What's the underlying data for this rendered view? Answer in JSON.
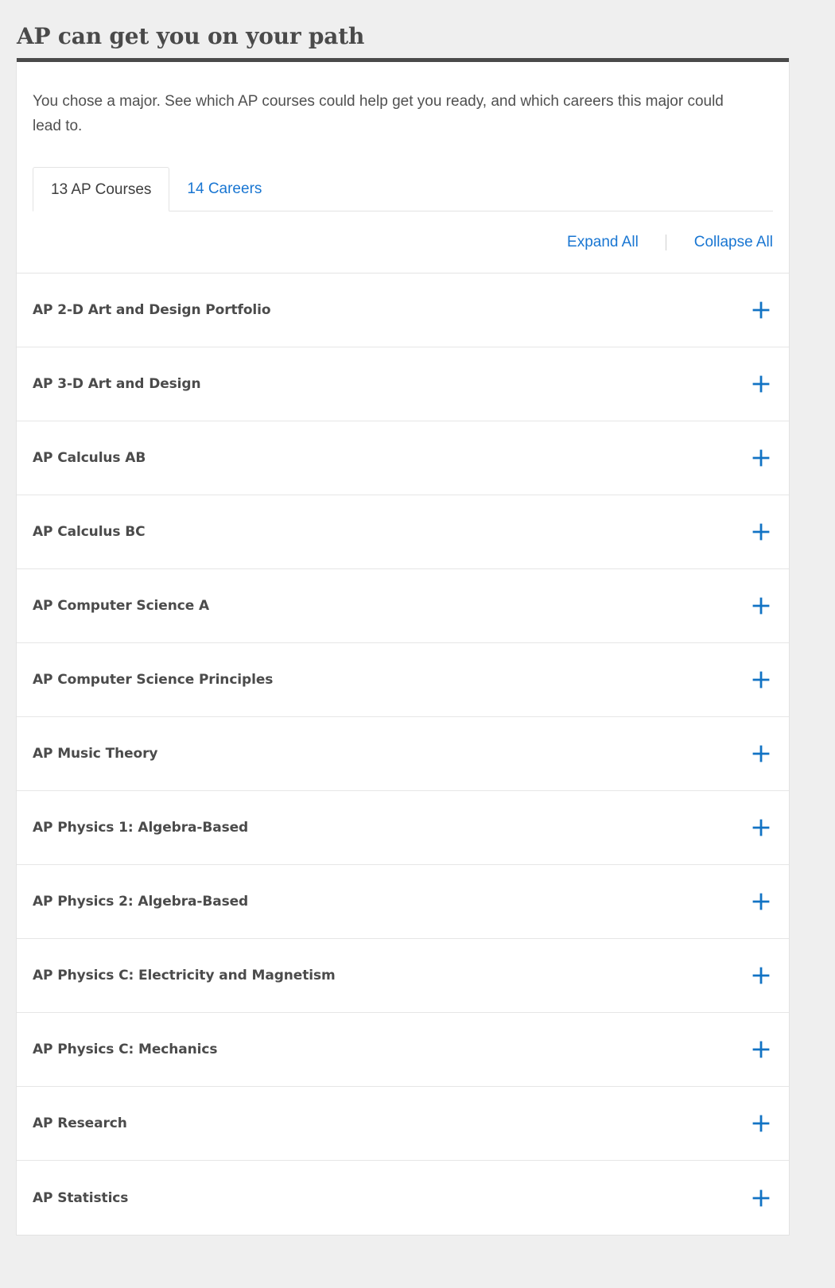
{
  "page": {
    "title": "AP can get you on your path",
    "background_color": "#efefef"
  },
  "card": {
    "accent_bar_color": "#4a4a4a",
    "intro": "You chose a major. See which AP courses could help get you ready, and which careers this major could lead to.",
    "tabs": [
      {
        "label": "13 AP Courses",
        "active": true
      },
      {
        "label": "14 Careers",
        "active": false
      }
    ],
    "toolbar": {
      "expand_all_label": "Expand All",
      "collapse_all_label": "Collapse All",
      "link_color": "#1976d2"
    },
    "courses": [
      {
        "name": "AP 2-D Art and Design Portfolio",
        "toggle_icon": "plus-icon"
      },
      {
        "name": "AP 3-D Art and Design",
        "toggle_icon": "plus-icon"
      },
      {
        "name": "AP Calculus AB",
        "toggle_icon": "plus-icon"
      },
      {
        "name": "AP Calculus BC",
        "toggle_icon": "plus-icon"
      },
      {
        "name": "AP Computer Science A",
        "toggle_icon": "plus-icon"
      },
      {
        "name": "AP Computer Science Principles",
        "toggle_icon": "plus-icon"
      },
      {
        "name": "AP Music Theory",
        "toggle_icon": "plus-icon"
      },
      {
        "name": "AP Physics 1: Algebra-Based",
        "toggle_icon": "plus-icon"
      },
      {
        "name": "AP Physics 2: Algebra-Based",
        "toggle_icon": "plus-icon"
      },
      {
        "name": "AP Physics C: Electricity and Magnetism",
        "toggle_icon": "plus-icon"
      },
      {
        "name": "AP Physics C: Mechanics",
        "toggle_icon": "plus-icon"
      },
      {
        "name": "AP Research",
        "toggle_icon": "plus-icon"
      },
      {
        "name": "AP Statistics",
        "toggle_icon": "plus-icon"
      }
    ]
  }
}
